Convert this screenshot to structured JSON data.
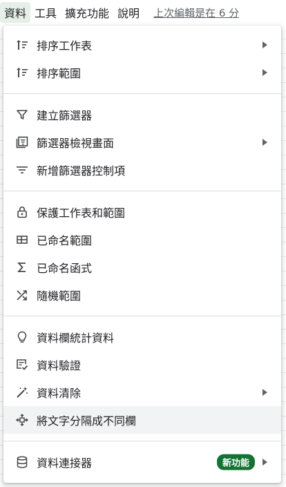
{
  "menubar": {
    "items": [
      {
        "label": "資料",
        "active": true
      },
      {
        "label": "工具",
        "active": false
      },
      {
        "label": "擴充功能",
        "active": false
      },
      {
        "label": "說明",
        "active": false
      }
    ],
    "last_edit": "上次編輯是在 6 分"
  },
  "dropdown": {
    "groups": [
      [
        {
          "icon": "sort-icon",
          "label": "排序工作表",
          "submenu": true
        },
        {
          "icon": "sort-icon",
          "label": "排序範圍",
          "submenu": true
        }
      ],
      [
        {
          "icon": "filter-icon",
          "label": "建立篩選器",
          "submenu": false
        },
        {
          "icon": "filter-view-icon",
          "label": "篩選器檢視畫面",
          "submenu": true
        },
        {
          "icon": "slicer-icon",
          "label": "新增篩選器控制項",
          "submenu": false
        }
      ],
      [
        {
          "icon": "lock-icon",
          "label": "保護工作表和範圍",
          "submenu": false
        },
        {
          "icon": "named-range-icon",
          "label": "已命名範圍",
          "submenu": false
        },
        {
          "icon": "sigma-icon",
          "label": "已命名函式",
          "submenu": false
        },
        {
          "icon": "shuffle-icon",
          "label": "隨機範圍",
          "submenu": false
        }
      ],
      [
        {
          "icon": "lightbulb-icon",
          "label": "資料欄統計資料",
          "submenu": false
        },
        {
          "icon": "data-validation-icon",
          "label": "資料驗證",
          "submenu": false
        },
        {
          "icon": "magic-wand-icon",
          "label": "資料清除",
          "submenu": true
        },
        {
          "icon": "split-text-icon",
          "label": "將文字分隔成不同欄",
          "submenu": false,
          "hover": true
        }
      ],
      [
        {
          "icon": "database-icon",
          "label": "資料連接器",
          "submenu": true,
          "badge": "新功能"
        }
      ]
    ]
  },
  "colors": {
    "active_menu_bg": "#e6f0e8",
    "hover_bg": "#f1f3f4",
    "badge_bg": "#137333",
    "separator": "#dadce0"
  }
}
